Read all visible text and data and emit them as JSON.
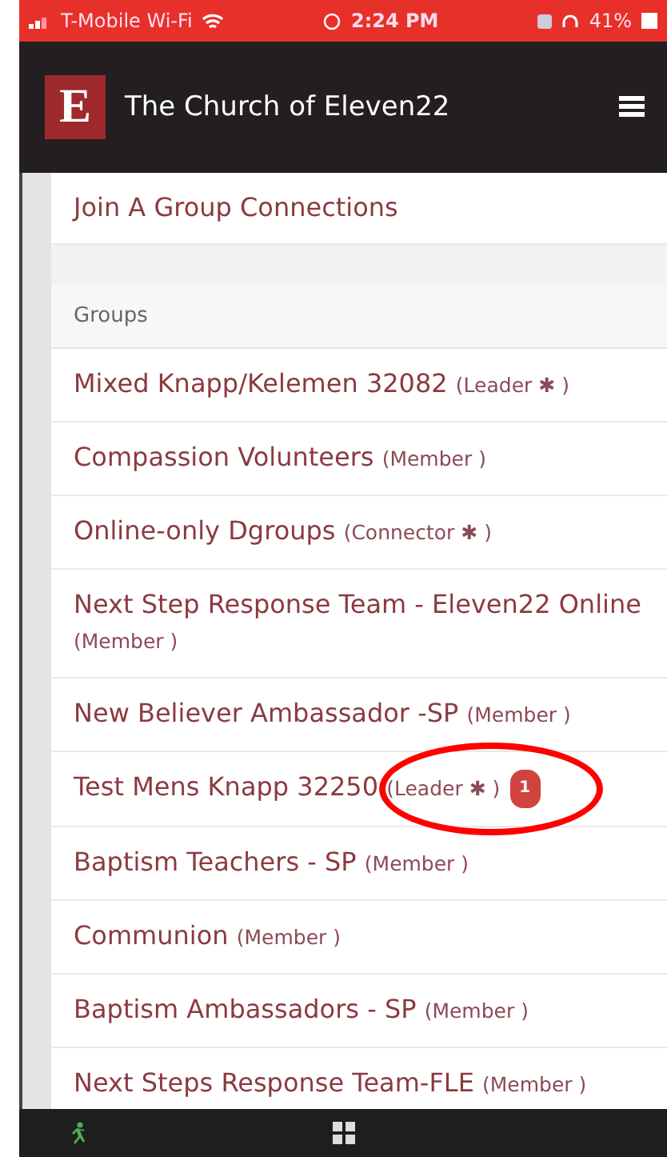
{
  "status_bar": {
    "carrier": "T-Mobile Wi-Fi",
    "time": "2:24 PM",
    "battery": "41%"
  },
  "header": {
    "logo_letter": "E",
    "title": "The Church of Eleven22"
  },
  "links": [
    {
      "label": "Join A Group Connections"
    }
  ],
  "groups": {
    "heading": "Groups",
    "items": [
      {
        "name": "Mixed Knapp/Kelemen 32082",
        "role": "(Leader ✱ )",
        "circled": false
      },
      {
        "name": "Compassion Volunteers",
        "role": "(Member )",
        "circled": false
      },
      {
        "name": "Online-only Dgroups",
        "role": "(Connector ✱ )",
        "circled": false
      },
      {
        "name": "Next Step Response Team - Eleven22 Online",
        "role": "(Member )",
        "circled": false
      },
      {
        "name": "New Believer Ambassador -SP",
        "role": "(Member )",
        "circled": false
      },
      {
        "name": "Test Mens Knapp 32250",
        "role": "(Leader ✱ )",
        "badge": "1",
        "circled": true
      },
      {
        "name": "Baptism Teachers - SP",
        "role": "(Member )",
        "circled": false
      },
      {
        "name": "Communion",
        "role": "(Member )",
        "circled": false
      },
      {
        "name": "Baptism Ambassadors - SP",
        "role": "(Member )",
        "circled": false
      },
      {
        "name": "Next Steps Response Team-FLE",
        "role": "(Member )",
        "circled": false
      }
    ]
  }
}
